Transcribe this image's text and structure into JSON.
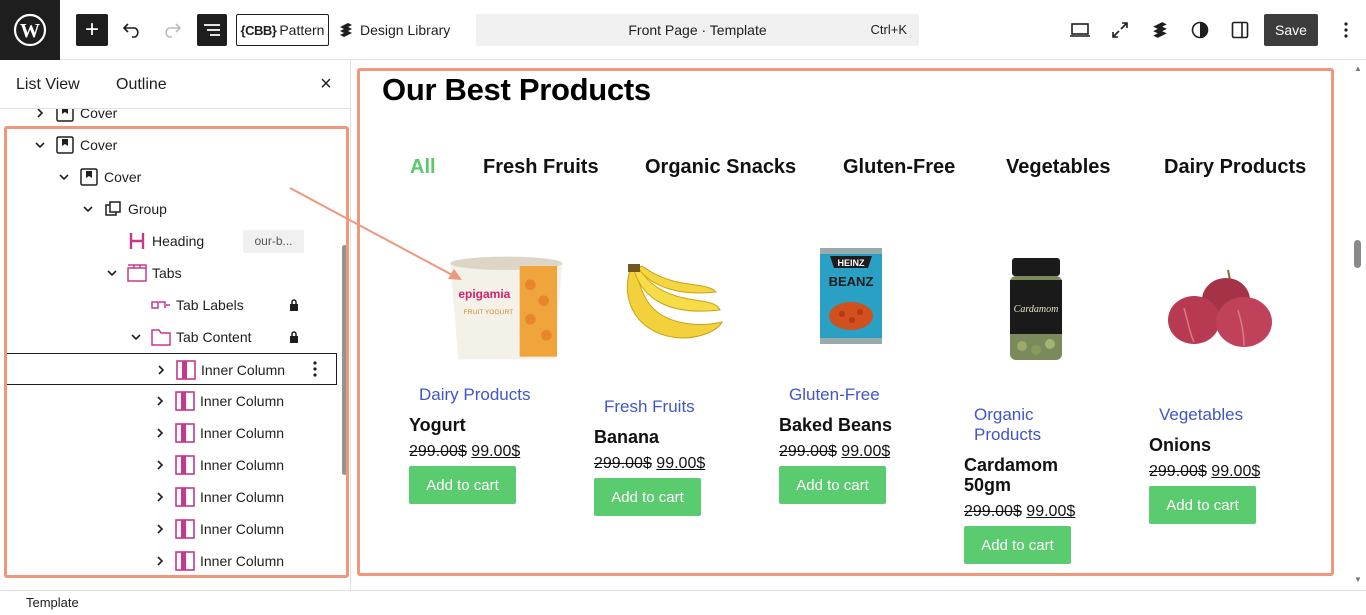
{
  "topbar": {
    "pattern_prefix": "{CBB}",
    "pattern_label": "Pattern",
    "design_library_label": "Design Library",
    "command_title": "Front Page · Template",
    "command_shortcut": "Ctrl+K",
    "save_label": "Save",
    "right_icons": [
      "laptop-icon",
      "fullscreen-icon",
      "stackable-icon",
      "contrast-icon",
      "sidebar-icon"
    ]
  },
  "panel": {
    "tabs": [
      "List View",
      "Outline"
    ],
    "close_symbol": "×",
    "tree": [
      {
        "label": "Cover",
        "icon": "cover-icon",
        "chevron": "right"
      },
      {
        "label": "Cover",
        "icon": "cover-icon",
        "chevron": "down"
      },
      {
        "label": "Cover",
        "icon": "cover-icon",
        "chevron": "down"
      },
      {
        "label": "Group",
        "icon": "group-icon",
        "chevron": "down"
      },
      {
        "label": "Heading",
        "icon": "heading-icon",
        "anchor": "our-b..."
      },
      {
        "label": "Tabs",
        "icon": "tabs-icon",
        "chevron": "down"
      },
      {
        "label": "Tab Labels",
        "icon": "tab-labels-icon",
        "locked": true
      },
      {
        "label": "Tab Content",
        "icon": "tab-content-icon",
        "chevron": "down",
        "locked": true
      },
      {
        "label": "Inner Column",
        "icon": "column-icon",
        "chevron": "right",
        "selected": true
      },
      {
        "label": "Inner Column",
        "icon": "column-icon",
        "chevron": "right"
      },
      {
        "label": "Inner Column",
        "icon": "column-icon",
        "chevron": "right"
      },
      {
        "label": "Inner Column",
        "icon": "column-icon",
        "chevron": "right"
      },
      {
        "label": "Inner Column",
        "icon": "column-icon",
        "chevron": "right"
      },
      {
        "label": "Inner Column",
        "icon": "column-icon",
        "chevron": "right"
      },
      {
        "label": "Inner Column",
        "icon": "column-icon",
        "chevron": "right"
      }
    ]
  },
  "canvas": {
    "heading": "Our Best Products",
    "tabs": [
      "All",
      "Fresh Fruits",
      "Organic Snacks",
      "Gluten-Free",
      "Vegetables",
      "Dairy Products"
    ],
    "active_tab": "All",
    "products": [
      {
        "category": "Dairy Products",
        "name": "Yogurt",
        "old_price": "299.00$",
        "new_price": "99.00$",
        "button": "Add to cart",
        "image": "yogurt-image"
      },
      {
        "category": "Fresh Fruits",
        "name": "Banana",
        "old_price": "299.00$",
        "new_price": "99.00$",
        "button": "Add to cart",
        "image": "banana-image"
      },
      {
        "category": "Gluten-Free",
        "name": "Baked Beans",
        "old_price": "299.00$",
        "new_price": "99.00$",
        "button": "Add to cart",
        "image": "baked-beans-image"
      },
      {
        "category": "Organic Products",
        "name": "Cardamom 50gm",
        "old_price": "299.00$",
        "new_price": "99.00$",
        "button": "Add to cart",
        "image": "cardamom-image"
      },
      {
        "category": "Vegetables",
        "name": "Onions",
        "old_price": "299.00$",
        "new_price": "99.00$",
        "button": "Add to cart",
        "image": "onion-image"
      }
    ],
    "image_text": {
      "yogurt_brand": "epigamia",
      "yogurt_sub": "FRUIT YOGURT",
      "beans_brand_1": "HEINZ",
      "beans_brand_2": "BEANZ",
      "cardamom_label": "Cardamom"
    }
  },
  "footer": {
    "breadcrumb": "Template"
  },
  "colors": {
    "accent_green": "#5acb6f",
    "category_blue": "#4255c6",
    "highlight_orange": "#ef977a",
    "block_icon_magenta": "#c5398d"
  }
}
